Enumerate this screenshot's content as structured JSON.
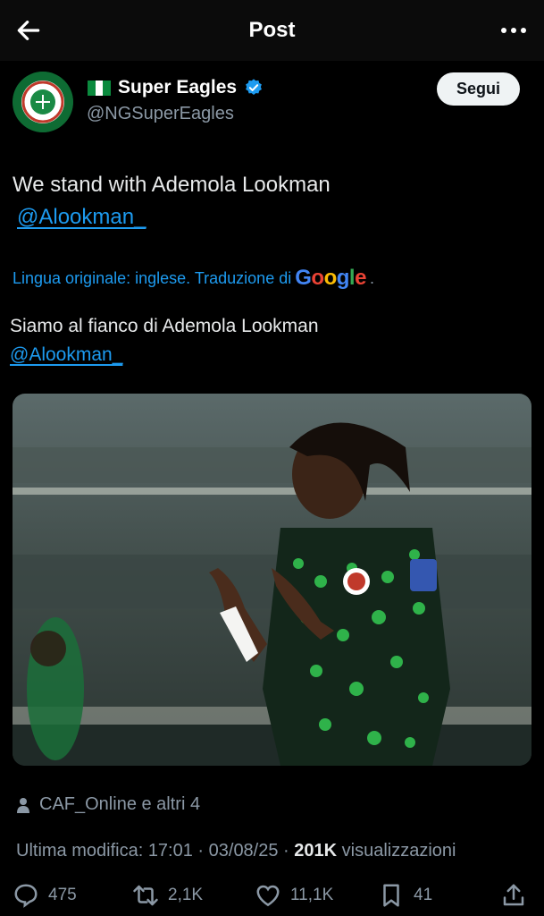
{
  "header": {
    "title": "Post"
  },
  "author": {
    "display_name": "Super Eagles",
    "handle": "@NGSuperEagles",
    "follow_label": "Segui",
    "flag_colors": [
      "#0b8a3e",
      "#ffffff",
      "#0b8a3e"
    ]
  },
  "tweet": {
    "text": "We stand with Ademola Lookman",
    "mention": "@Alookman_",
    "translation_label": "Lingua originale: inglese. Traduzione di",
    "translation_brand": "Google",
    "translated_text": "Siamo al fianco di Ademola Lookman",
    "translated_mention": "@Alookman_"
  },
  "media": {
    "description_icon": "photo"
  },
  "reposted_by": "CAF_Online e altri 4",
  "meta": {
    "prefix": "Ultima modifica: 17:01 · 03/08/25 · ",
    "views_count": "201K",
    "views_label": "visualizzazioni"
  },
  "actions": {
    "replies": "475",
    "reposts": "2,1K",
    "likes": "11,1K",
    "bookmarks": "41"
  },
  "colors": {
    "accent": "#1d9bf0",
    "muted": "#8b98a5",
    "background": "#000000"
  }
}
